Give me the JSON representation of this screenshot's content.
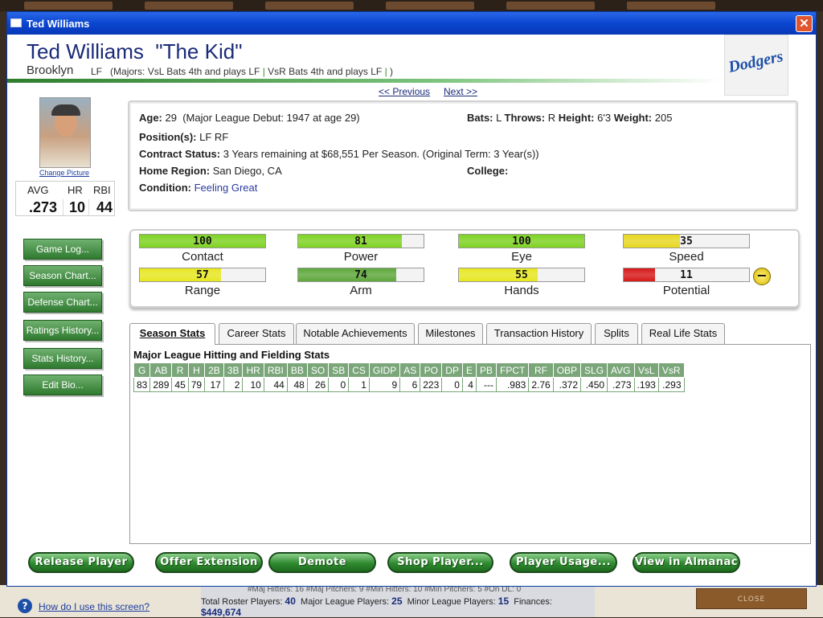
{
  "window": {
    "title": "Ted Williams",
    "close_glyph": "✕"
  },
  "player": {
    "name": "Ted Williams  \"The Kid\"",
    "team": "Brooklyn",
    "position": "LF",
    "lineup_prefix": "(Majors: VsL Bats 4th and plays LF",
    "lineup_sep1": "|",
    "lineup_vsr": "VsR Bats 4th and plays LF",
    "lineup_sep2": "|",
    "lineup_suffix": ")",
    "team_logo_text": "Dodgers"
  },
  "nav": {
    "previous": "<< Previous",
    "next": "Next >>"
  },
  "photo": {
    "change_label": "Change Picture"
  },
  "mini_stats": {
    "headers": [
      "AVG",
      "HR",
      "RBI"
    ],
    "values": [
      ".273",
      "10",
      "44"
    ]
  },
  "left_buttons": [
    "Game Log...",
    "Season Chart...",
    "Defense Chart...",
    "Ratings History...",
    "Stats History...",
    "Edit Bio..."
  ],
  "info": {
    "age_label": "Age:",
    "age_value": "29  (Major League Debut: 1947 at age 29)",
    "bats_label": "Bats:",
    "bats_value": "L",
    "throws_label": "Throws:",
    "throws_value": "R",
    "height_label": "Height:",
    "height_value": "6'3",
    "weight_label": "Weight:",
    "weight_value": "205",
    "positions_label": "Position(s):",
    "positions_value": "LF RF",
    "contract_label": "Contract Status:",
    "contract_value": "3 Years remaining at $68,551 Per Season. (Original Term: 3 Year(s))",
    "region_label": "Home Region:",
    "region_value": "San Diego, CA",
    "college_label": "College:",
    "college_value": "",
    "condition_label": "Condition:",
    "condition_value": "Feeling Great"
  },
  "ratings": [
    {
      "label": "Contact",
      "value": "100",
      "fraction": 1.0,
      "color": "#7ed321"
    },
    {
      "label": "Power",
      "value": "81",
      "fraction": 0.83,
      "color": "#7ed321"
    },
    {
      "label": "Eye",
      "value": "100",
      "fraction": 1.0,
      "color": "#7ed321"
    },
    {
      "label": "Speed",
      "value": "35",
      "fraction": 0.45,
      "color": "#e8d820"
    },
    {
      "label": "Range",
      "value": "57",
      "fraction": 0.65,
      "color": "#e8e820"
    },
    {
      "label": "Arm",
      "value": "74",
      "fraction": 0.78,
      "color": "#5da83a"
    },
    {
      "label": "Hands",
      "value": "55",
      "fraction": 0.63,
      "color": "#e8e820"
    },
    {
      "label": "Potential",
      "value": "11",
      "fraction": 0.25,
      "color": "#d81818"
    }
  ],
  "potential_button": "−",
  "tabs": [
    "Season Stats",
    "Career Stats",
    "Notable Achievements",
    "Milestones",
    "Transaction History",
    "Splits",
    "Real Life Stats"
  ],
  "stats": {
    "title": "Major League Hitting and Fielding Stats",
    "headers": [
      "G",
      "AB",
      "R",
      "H",
      "2B",
      "3B",
      "HR",
      "RBI",
      "BB",
      "SO",
      "SB",
      "CS",
      "GIDP",
      "AS",
      "PO",
      "DP",
      "E",
      "PB",
      "FPCT",
      "RF",
      "OBP",
      "SLG",
      "AVG",
      "VsL",
      "VsR"
    ],
    "rows": [
      [
        "83",
        "289",
        "45",
        "79",
        "17",
        "2",
        "10",
        "44",
        "48",
        "26",
        "0",
        "1",
        "9",
        "6",
        "223",
        "0",
        "4",
        "---",
        ".983",
        "2.76",
        ".372",
        ".450",
        ".273",
        ".193",
        ".293"
      ]
    ]
  },
  "bottom_buttons": [
    "Release Player",
    "Offer Extension",
    "Demote",
    "Shop Player...",
    "Player Usage...",
    "View in Almanac"
  ],
  "background": {
    "help_glyph": "?",
    "help_link": "How do I use this screen?",
    "roster_line1": "#Maj Hitters: 16  #Maj Pitchers: 9  #Min Hitters: 10  #Min Pitchers: 5  #On DL: 0",
    "total_label": "Total Roster Players:",
    "total_value": "40",
    "major_label": "Major League Players:",
    "major_value": "25",
    "minor_label": "Minor League Players:",
    "minor_value": "15",
    "finances_label": "Finances:",
    "finances_value": "$449,674",
    "close_label": "CLOSE"
  }
}
